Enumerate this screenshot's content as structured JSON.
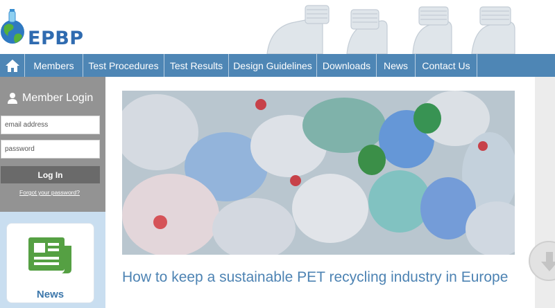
{
  "brand": {
    "name": "EPBP",
    "accent": "#4e86b5",
    "logo_blue": "#2f6bb0"
  },
  "nav": {
    "home_icon": "home-icon",
    "items": [
      {
        "label": "Members"
      },
      {
        "label": "Test Procedures"
      },
      {
        "label": "Test Results"
      },
      {
        "label": "Design Guidelines"
      },
      {
        "label": "Downloads"
      },
      {
        "label": "News"
      },
      {
        "label": "Contact Us"
      }
    ]
  },
  "login": {
    "title": "Member Login",
    "user_icon": "user-icon",
    "email_placeholder": "email address",
    "password_placeholder": "password",
    "button_label": "Log In",
    "forgot_label": "Forgot your password?"
  },
  "news_card": {
    "icon": "newspaper-icon",
    "label": "News"
  },
  "main": {
    "headline": "How to keep a sustainable PET recycling industry in Europe"
  }
}
